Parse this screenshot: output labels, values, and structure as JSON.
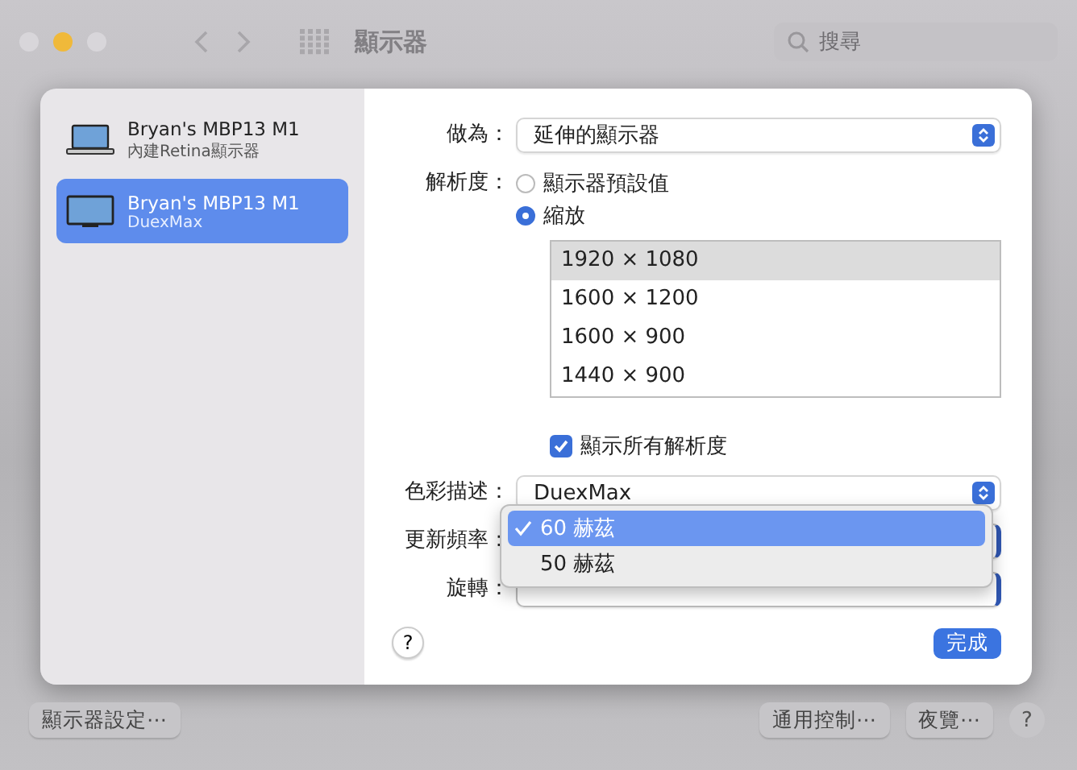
{
  "window": {
    "title": "顯示器",
    "search": {
      "placeholder": "搜尋"
    }
  },
  "sidebar": {
    "items": [
      {
        "name": "Bryan's MBP13 M1",
        "subtitle": "內建Retina顯示器",
        "kind": "laptop",
        "selected": false
      },
      {
        "name": "Bryan's MBP13 M1",
        "subtitle": "DuexMax",
        "kind": "monitor",
        "selected": true
      }
    ]
  },
  "settings": {
    "use_as": {
      "label": "做為：",
      "value": "延伸的顯示器"
    },
    "resolution": {
      "label": "解析度：",
      "options": [
        {
          "label": "顯示器預設值",
          "selected": false
        },
        {
          "label": "縮放",
          "selected": true
        }
      ],
      "sizes": [
        {
          "label": "1920 × 1080",
          "selected": true
        },
        {
          "label": "1600 × 1200",
          "selected": false
        },
        {
          "label": "1600 × 900",
          "selected": false
        },
        {
          "label": "1440 × 900",
          "selected": false
        }
      ],
      "show_all": {
        "label": "顯示所有解析度",
        "checked": true
      }
    },
    "color_profile": {
      "label": "色彩描述：",
      "value": "DuexMax"
    },
    "refresh_rate": {
      "label": "更新頻率：",
      "menu": [
        {
          "label": "60 赫茲",
          "selected": true
        },
        {
          "label": "50 赫茲",
          "selected": false
        }
      ]
    },
    "rotation": {
      "label": "旋轉："
    },
    "help": "?",
    "done": "完成"
  },
  "footer": {
    "buttons": [
      "顯示器設定⋯",
      "通用控制⋯",
      "夜覽⋯"
    ],
    "help": "?"
  }
}
